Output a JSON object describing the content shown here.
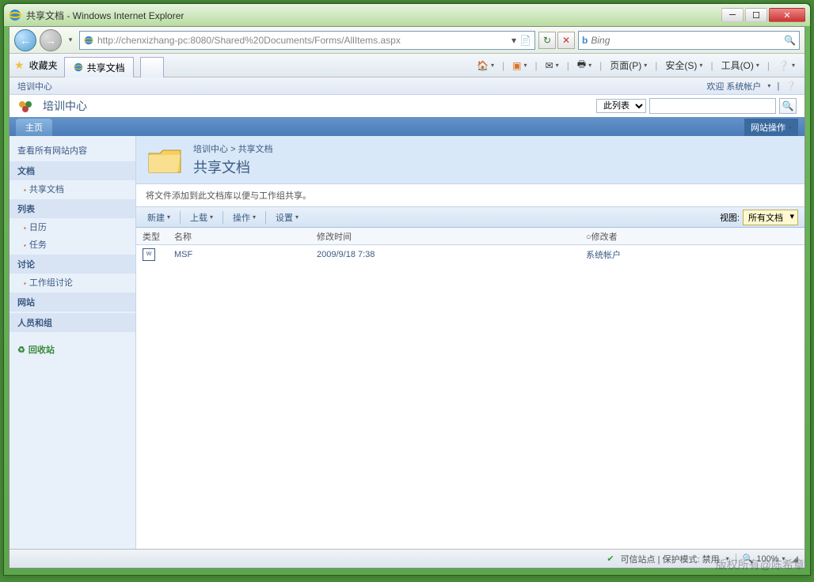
{
  "window": {
    "title": "共享文档 - Windows Internet Explorer"
  },
  "nav": {
    "url": "http://chenxizhang-pc:8080/Shared%20Documents/Forms/AllItems.aspx",
    "search_provider": "Bing"
  },
  "favbar": {
    "favorites": "收藏夹",
    "tab_title": "共享文档",
    "menu": {
      "page": "页面(P)",
      "safety": "安全(S)",
      "tools": "工具(O)"
    }
  },
  "sp": {
    "site_name": "培训中心",
    "welcome": "欢迎 系统帐户",
    "title": "培训中心",
    "list_dd": "此列表",
    "home_tab": "主页",
    "site_actions": "网站操作",
    "breadcrumb": {
      "root": "培训中心",
      "sep": ">",
      "leaf": "共享文档"
    },
    "lib_title": "共享文档",
    "description": "将文件添加到此文档库以便与工作组共享。",
    "toolbar": {
      "new": "新建",
      "upload": "上载",
      "actions": "操作",
      "settings": "设置",
      "view_label": "视图:",
      "view_value": "所有文档"
    },
    "columns": {
      "type": "类型",
      "name": "名称",
      "modified": "修改时间",
      "modifier": "修改者"
    },
    "rows": [
      {
        "icon": "W",
        "name": "MSF",
        "modified": "2009/9/18 7:38",
        "modifier": "系统帐户"
      }
    ],
    "sidebar": {
      "view_all": "查看所有网站内容",
      "docs": "文档",
      "docs_items": [
        "共享文档"
      ],
      "lists": "列表",
      "lists_items": [
        "日历",
        "任务"
      ],
      "discussions": "讨论",
      "discussions_items": [
        "工作组讨论"
      ],
      "sites": "网站",
      "people": "人员和组",
      "recycle": "回收站"
    }
  },
  "status": {
    "trusted": "可信站点 | 保护模式: 禁用",
    "zoom": "100%"
  },
  "watermark": "版权所有@陈希章"
}
